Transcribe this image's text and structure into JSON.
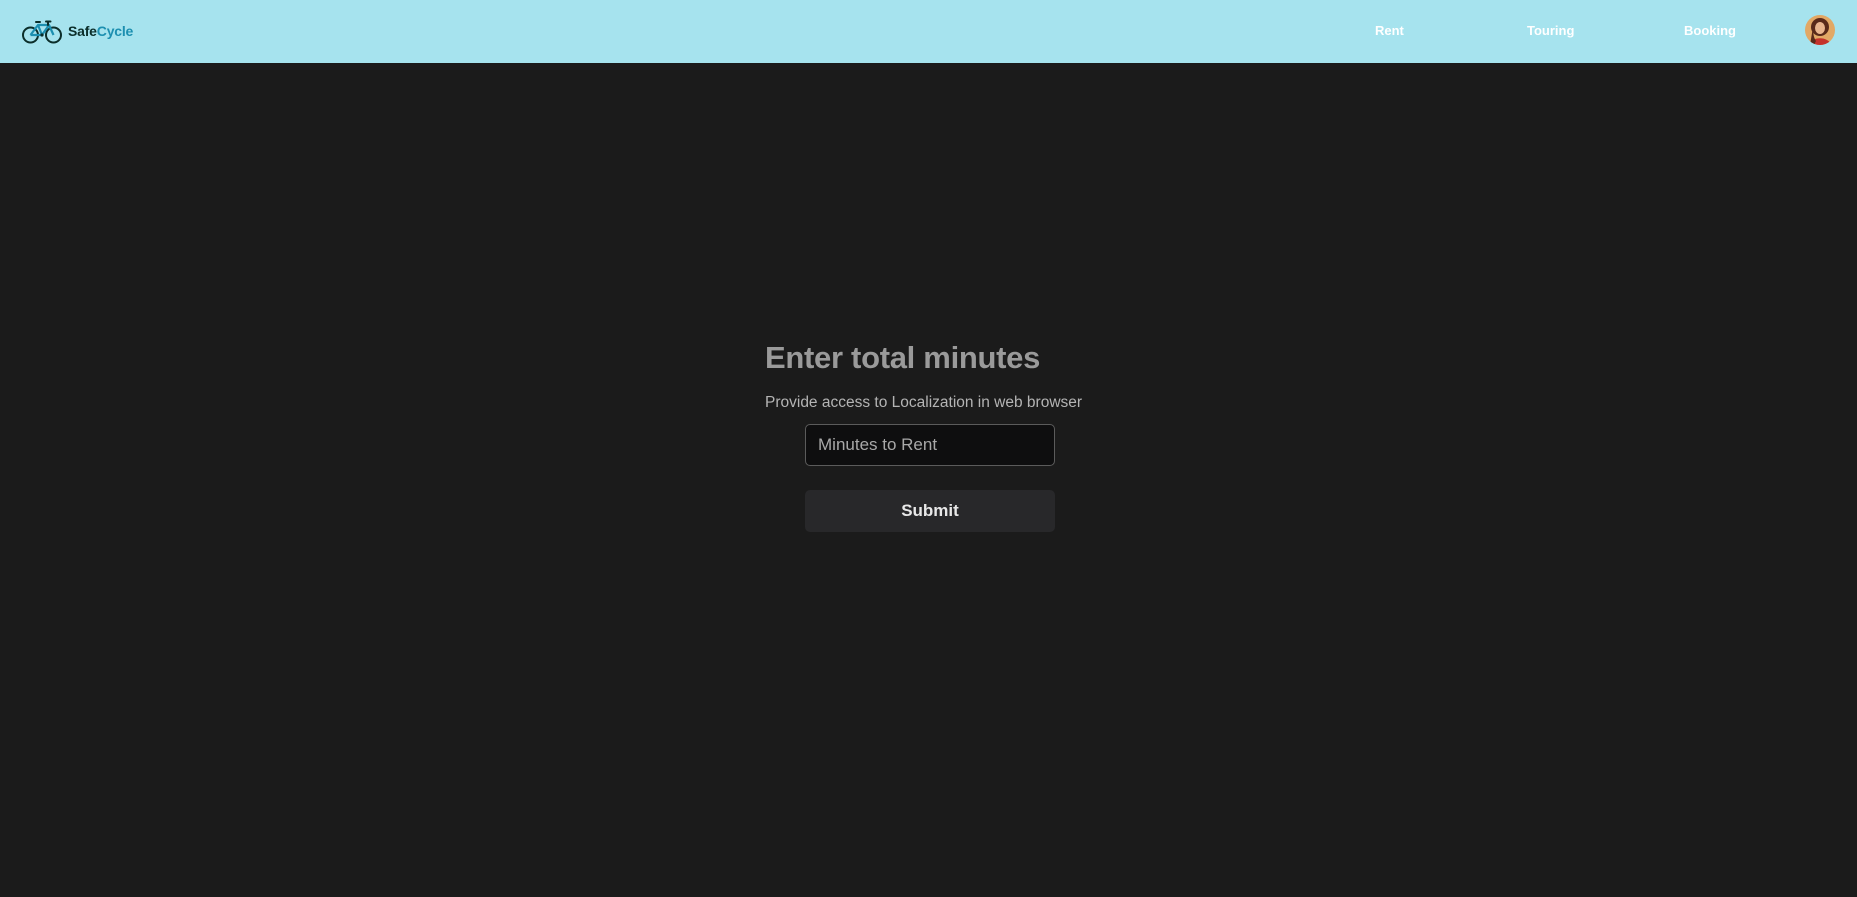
{
  "brand": {
    "name_part1": "Safe",
    "name_part2": "Cycle",
    "logo_icon": "bicycle-icon",
    "colors": {
      "dark": "#0b2e2a",
      "accent": "#1c8fb0"
    }
  },
  "nav": {
    "items": [
      {
        "label": "Rent"
      },
      {
        "label": "Touring"
      },
      {
        "label": "Booking"
      }
    ],
    "background": "#a6e3ee"
  },
  "user": {
    "avatar_icon": "user-avatar"
  },
  "form": {
    "title": "Enter total minutes",
    "subtitle": "Provide access to Localization in web browser",
    "minutes_placeholder": "Minutes to Rent",
    "minutes_value": "",
    "submit_label": "Submit"
  },
  "theme": {
    "page_background": "#1b1b1b",
    "input_background": "#0e0e0f",
    "button_background": "#28282a"
  }
}
